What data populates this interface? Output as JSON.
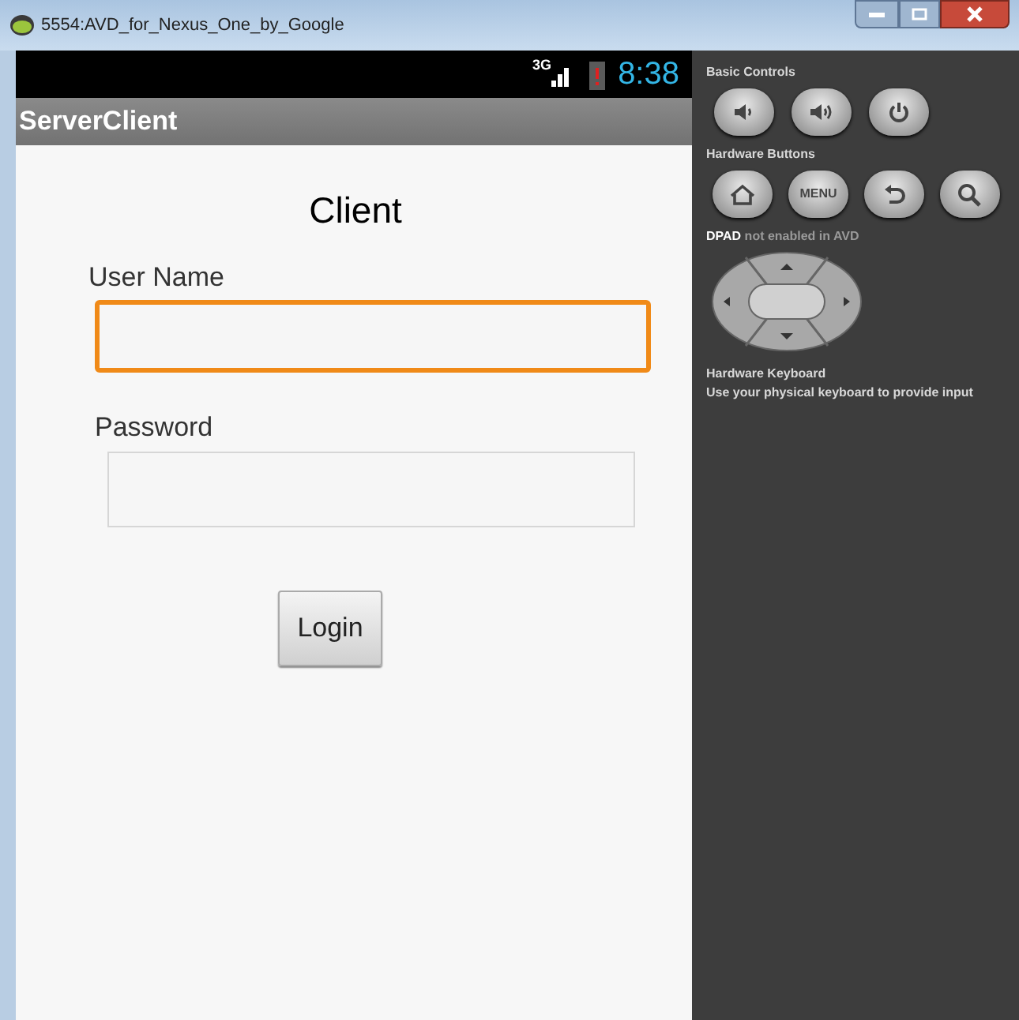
{
  "window": {
    "title": "5554:AVD_for_Nexus_One_by_Google"
  },
  "status_bar": {
    "network": "3G",
    "time": "8:38"
  },
  "app_bar": {
    "title": "ServerClient"
  },
  "form": {
    "heading": "Client",
    "fields": [
      {
        "label": "User Name",
        "focused": true
      },
      {
        "label": "Password",
        "focused": false
      }
    ],
    "button": "Login"
  },
  "controls": {
    "basic_title": "Basic Controls",
    "hardware_title": "Hardware Buttons",
    "menu_label": "MENU",
    "dpad_note": "**DPAD** not enabled in AVD",
    "keyboard_title": "Hardware Keyboard",
    "keyboard_note": "Use your physical keyboard to provide input"
  }
}
